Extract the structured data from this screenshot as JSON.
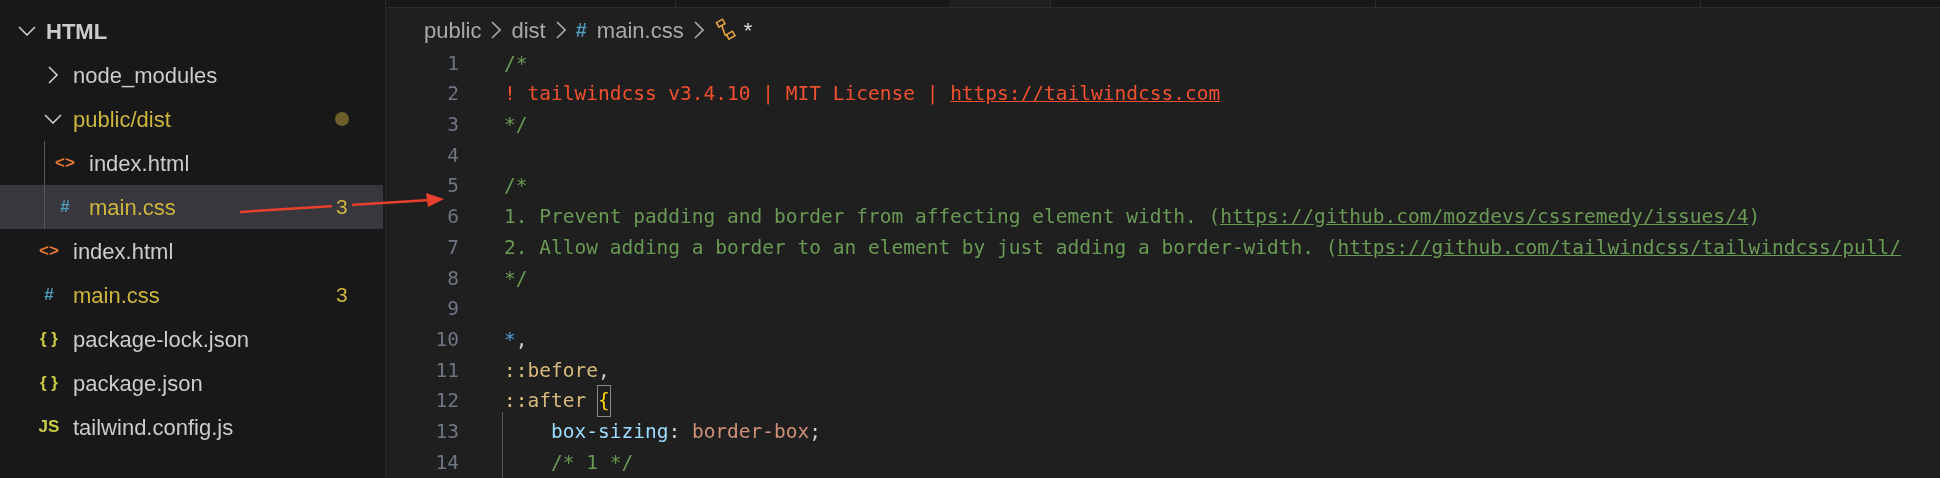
{
  "explorer": {
    "title": "HTML",
    "expanded": true,
    "items": [
      {
        "kind": "folder",
        "label": "node_modules",
        "expanded": false
      },
      {
        "kind": "folder",
        "label": "public/dist",
        "expanded": true,
        "modified": true,
        "warning": true,
        "children": [
          {
            "kind": "html",
            "icon": "<>",
            "label": "index.html",
            "selected": false
          },
          {
            "kind": "css",
            "icon": "#",
            "label": "main.css",
            "problems": "3",
            "warning": true,
            "selected": true
          }
        ]
      },
      {
        "kind": "html",
        "icon": "<>",
        "label": "index.html",
        "selected": false
      },
      {
        "kind": "css",
        "icon": "#",
        "label": "main.css",
        "problems": "3",
        "warning": true,
        "selected": false
      },
      {
        "kind": "json",
        "icon": "{ }",
        "label": "package-lock.json",
        "selected": false
      },
      {
        "kind": "json",
        "icon": "{ }",
        "label": "package.json",
        "selected": false
      },
      {
        "kind": "js",
        "icon": "JS",
        "label": "tailwind.config.js",
        "selected": false
      }
    ]
  },
  "breadcrumb": [
    {
      "kind": "folder",
      "label": "public"
    },
    {
      "kind": "folder",
      "label": "dist"
    },
    {
      "kind": "file",
      "icon": "#",
      "label": "main.css"
    },
    {
      "kind": "symbol",
      "label": "*"
    }
  ],
  "code": [
    {
      "number": "1",
      "tokens": [
        {
          "kind": "comment",
          "text": "/*"
        }
      ]
    },
    {
      "number": "2",
      "tokens": [
        {
          "kind": "banner",
          "text": "! tailwindcss v3.4.10 | MIT License | "
        },
        {
          "kind": "banner-link",
          "text": "https://tailwindcss.com"
        }
      ]
    },
    {
      "number": "3",
      "tokens": [
        {
          "kind": "comment",
          "text": "*/"
        }
      ]
    },
    {
      "number": "4"
    },
    {
      "number": "5",
      "tokens": [
        {
          "kind": "comment",
          "text": "/*"
        }
      ]
    },
    {
      "number": "6",
      "tokens": [
        {
          "kind": "comment",
          "text": "1. Prevent padding and border from affecting element width. ("
        },
        {
          "kind": "comment-link",
          "text": "https://github.com/mozdevs/cssremedy/issues/4"
        },
        {
          "kind": "comment",
          "text": ")"
        }
      ]
    },
    {
      "number": "7",
      "tokens": [
        {
          "kind": "comment",
          "text": "2. Allow adding a border to an element by just adding a border-width. ("
        },
        {
          "kind": "comment-link",
          "text": "https://github.com/tailwindcss/tailwindcss/pull/"
        }
      ]
    },
    {
      "number": "8",
      "tokens": [
        {
          "kind": "comment",
          "text": "*/"
        }
      ]
    },
    {
      "number": "9"
    },
    {
      "number": "10",
      "tokens": [
        {
          "kind": "universal",
          "text": "*"
        },
        {
          "kind": "punct",
          "text": ","
        }
      ]
    },
    {
      "number": "11",
      "tokens": [
        {
          "kind": "pseudo",
          "text": "::before"
        },
        {
          "kind": "punct",
          "text": ","
        }
      ]
    },
    {
      "number": "12",
      "tokens": [
        {
          "kind": "pseudo",
          "text": "::after "
        },
        {
          "kind": "bracket",
          "text": "{",
          "matched": true
        }
      ]
    },
    {
      "number": "13",
      "guide": true,
      "tokens": [
        {
          "kind": "property",
          "text": "box-sizing"
        },
        {
          "kind": "punct",
          "text": ": "
        },
        {
          "kind": "value",
          "text": "border-box"
        },
        {
          "kind": "punct",
          "text": ";"
        }
      ]
    },
    {
      "number": "14",
      "guide": true,
      "tokens": [
        {
          "kind": "comment",
          "text": "/* 1 */"
        }
      ]
    }
  ]
}
